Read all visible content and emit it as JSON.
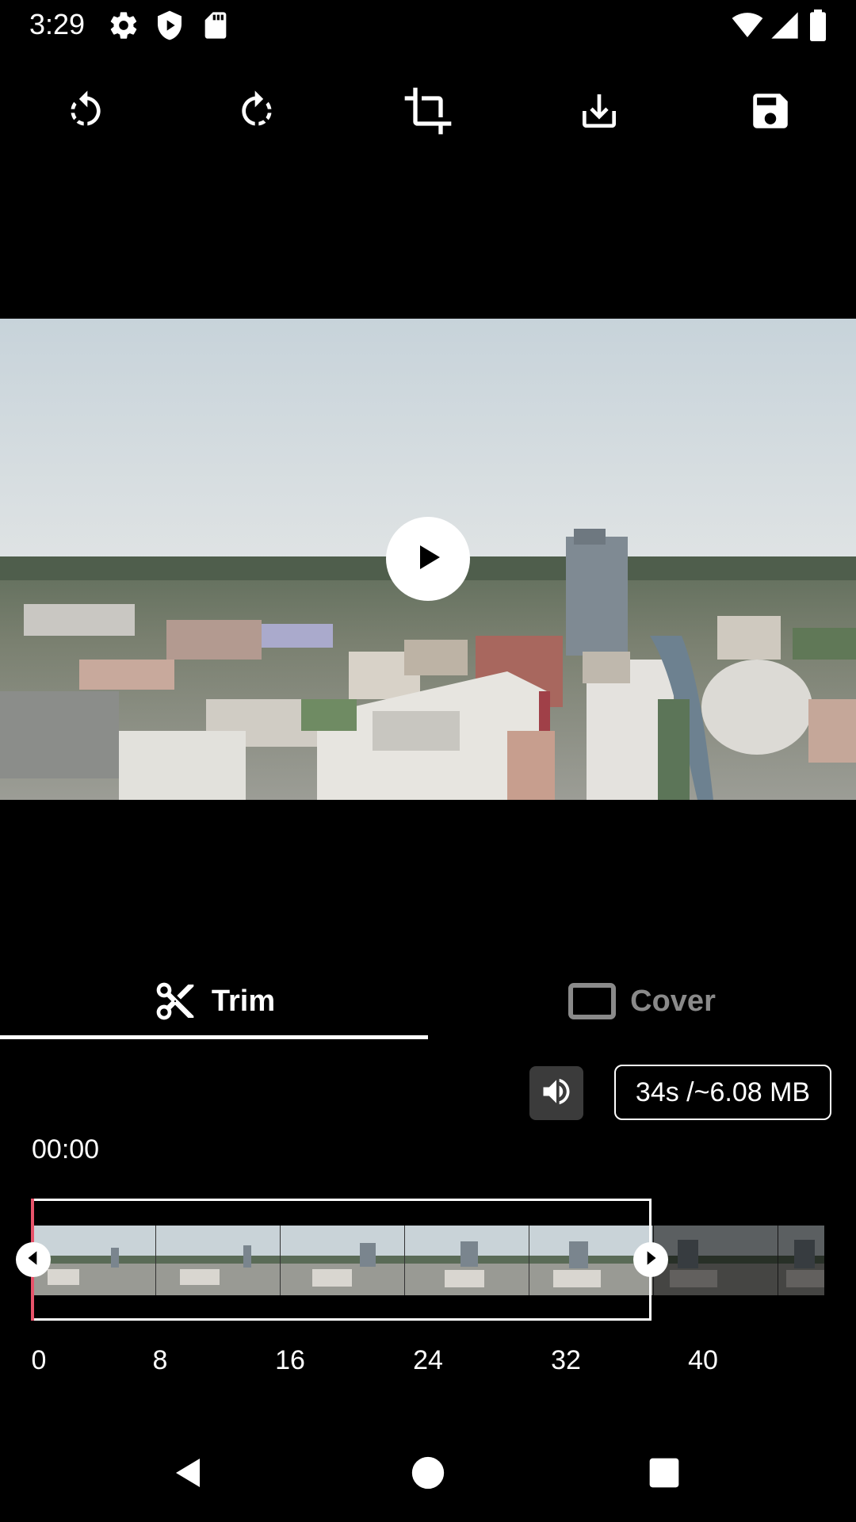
{
  "status_bar": {
    "time": "3:29",
    "left_icons": [
      "gear-icon",
      "shield-play-icon",
      "sd-card-icon"
    ],
    "right_icons": [
      "wifi-icon",
      "cell-signal-icon",
      "battery-icon"
    ]
  },
  "toolbar": {
    "icons": [
      "rotate-left-icon",
      "rotate-right-icon",
      "crop-icon",
      "download-icon",
      "save-icon"
    ]
  },
  "player": {
    "play_icon": "play-icon"
  },
  "tabs": [
    {
      "label": "Trim",
      "icon": "scissors-icon",
      "active": true
    },
    {
      "label": "Cover",
      "icon": "frame-icon",
      "active": false
    }
  ],
  "trim": {
    "volume_icon": "volume-icon",
    "size_info": "34s /~6.08 MB",
    "current_time": "00:00",
    "timeline_ticks": [
      "0",
      "8",
      "16",
      "24",
      "32",
      "40"
    ]
  },
  "nav": {
    "icons": [
      "back-icon",
      "home-icon",
      "recents-icon"
    ]
  },
  "colors": {
    "background": "#000000",
    "accent": "#ffffff",
    "selection_edge": "#e8536a",
    "inactive_tab": "#8a8a8a"
  }
}
